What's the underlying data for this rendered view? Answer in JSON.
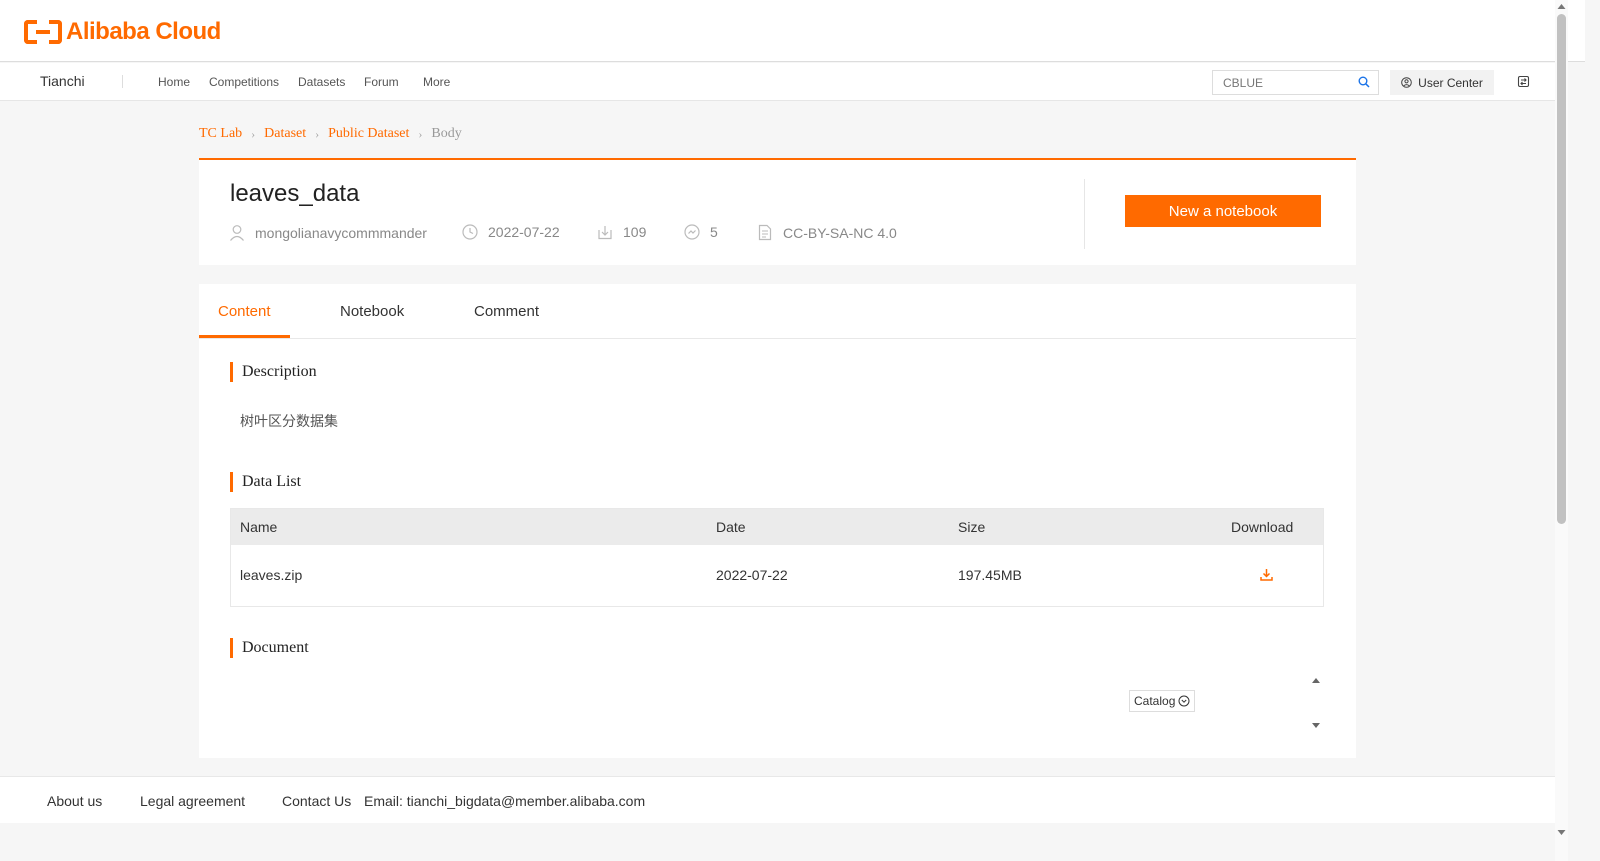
{
  "topbar": {
    "logo_text": "Alibaba Cloud",
    "logo_icon": "alibaba-cloud-logo-icon"
  },
  "nav": {
    "brand": "Tianchi",
    "items": [
      {
        "label": "Home"
      },
      {
        "label": "Competitions"
      },
      {
        "label": "Datasets"
      },
      {
        "label": "Forum"
      },
      {
        "label": "More"
      }
    ],
    "search_value": "CBLUE",
    "search_icon": "search-icon",
    "user_center": "User Center",
    "user_icon": "user-circle-icon",
    "lang_icon": "language-switch-icon"
  },
  "breadcrumb": [
    {
      "label": "TC Lab"
    },
    {
      "label": "Dataset"
    },
    {
      "label": "Public Dataset"
    },
    {
      "label": "Body"
    }
  ],
  "dataset": {
    "title": "leaves_data",
    "author": "mongolianavycommmander",
    "date": "2022-07-22",
    "downloads": "109",
    "references": "5",
    "license": "CC-BY-SA-NC 4.0",
    "new_notebook": "New a notebook"
  },
  "tabs": [
    {
      "label": "Content",
      "active": true
    },
    {
      "label": "Notebook",
      "active": false
    },
    {
      "label": "Comment",
      "active": false
    }
  ],
  "sections": {
    "description_title": "Description",
    "description_text": "树叶区分数据集",
    "data_list_title": "Data List",
    "document_title": "Document"
  },
  "table": {
    "headers": {
      "name": "Name",
      "date": "Date",
      "size": "Size",
      "download": "Download"
    },
    "rows": [
      {
        "name": "leaves.zip",
        "date": "2022-07-22",
        "size": "197.45MB"
      }
    ]
  },
  "catalog": {
    "label": "Catalog"
  },
  "footer": {
    "about": "About us",
    "legal": "Legal agreement",
    "contact": "Contact Us",
    "email": "Email: tianchi_bigdata@member.alibaba.com"
  },
  "colors": {
    "accent": "#ff6a00",
    "background": "#f6f6f6"
  }
}
